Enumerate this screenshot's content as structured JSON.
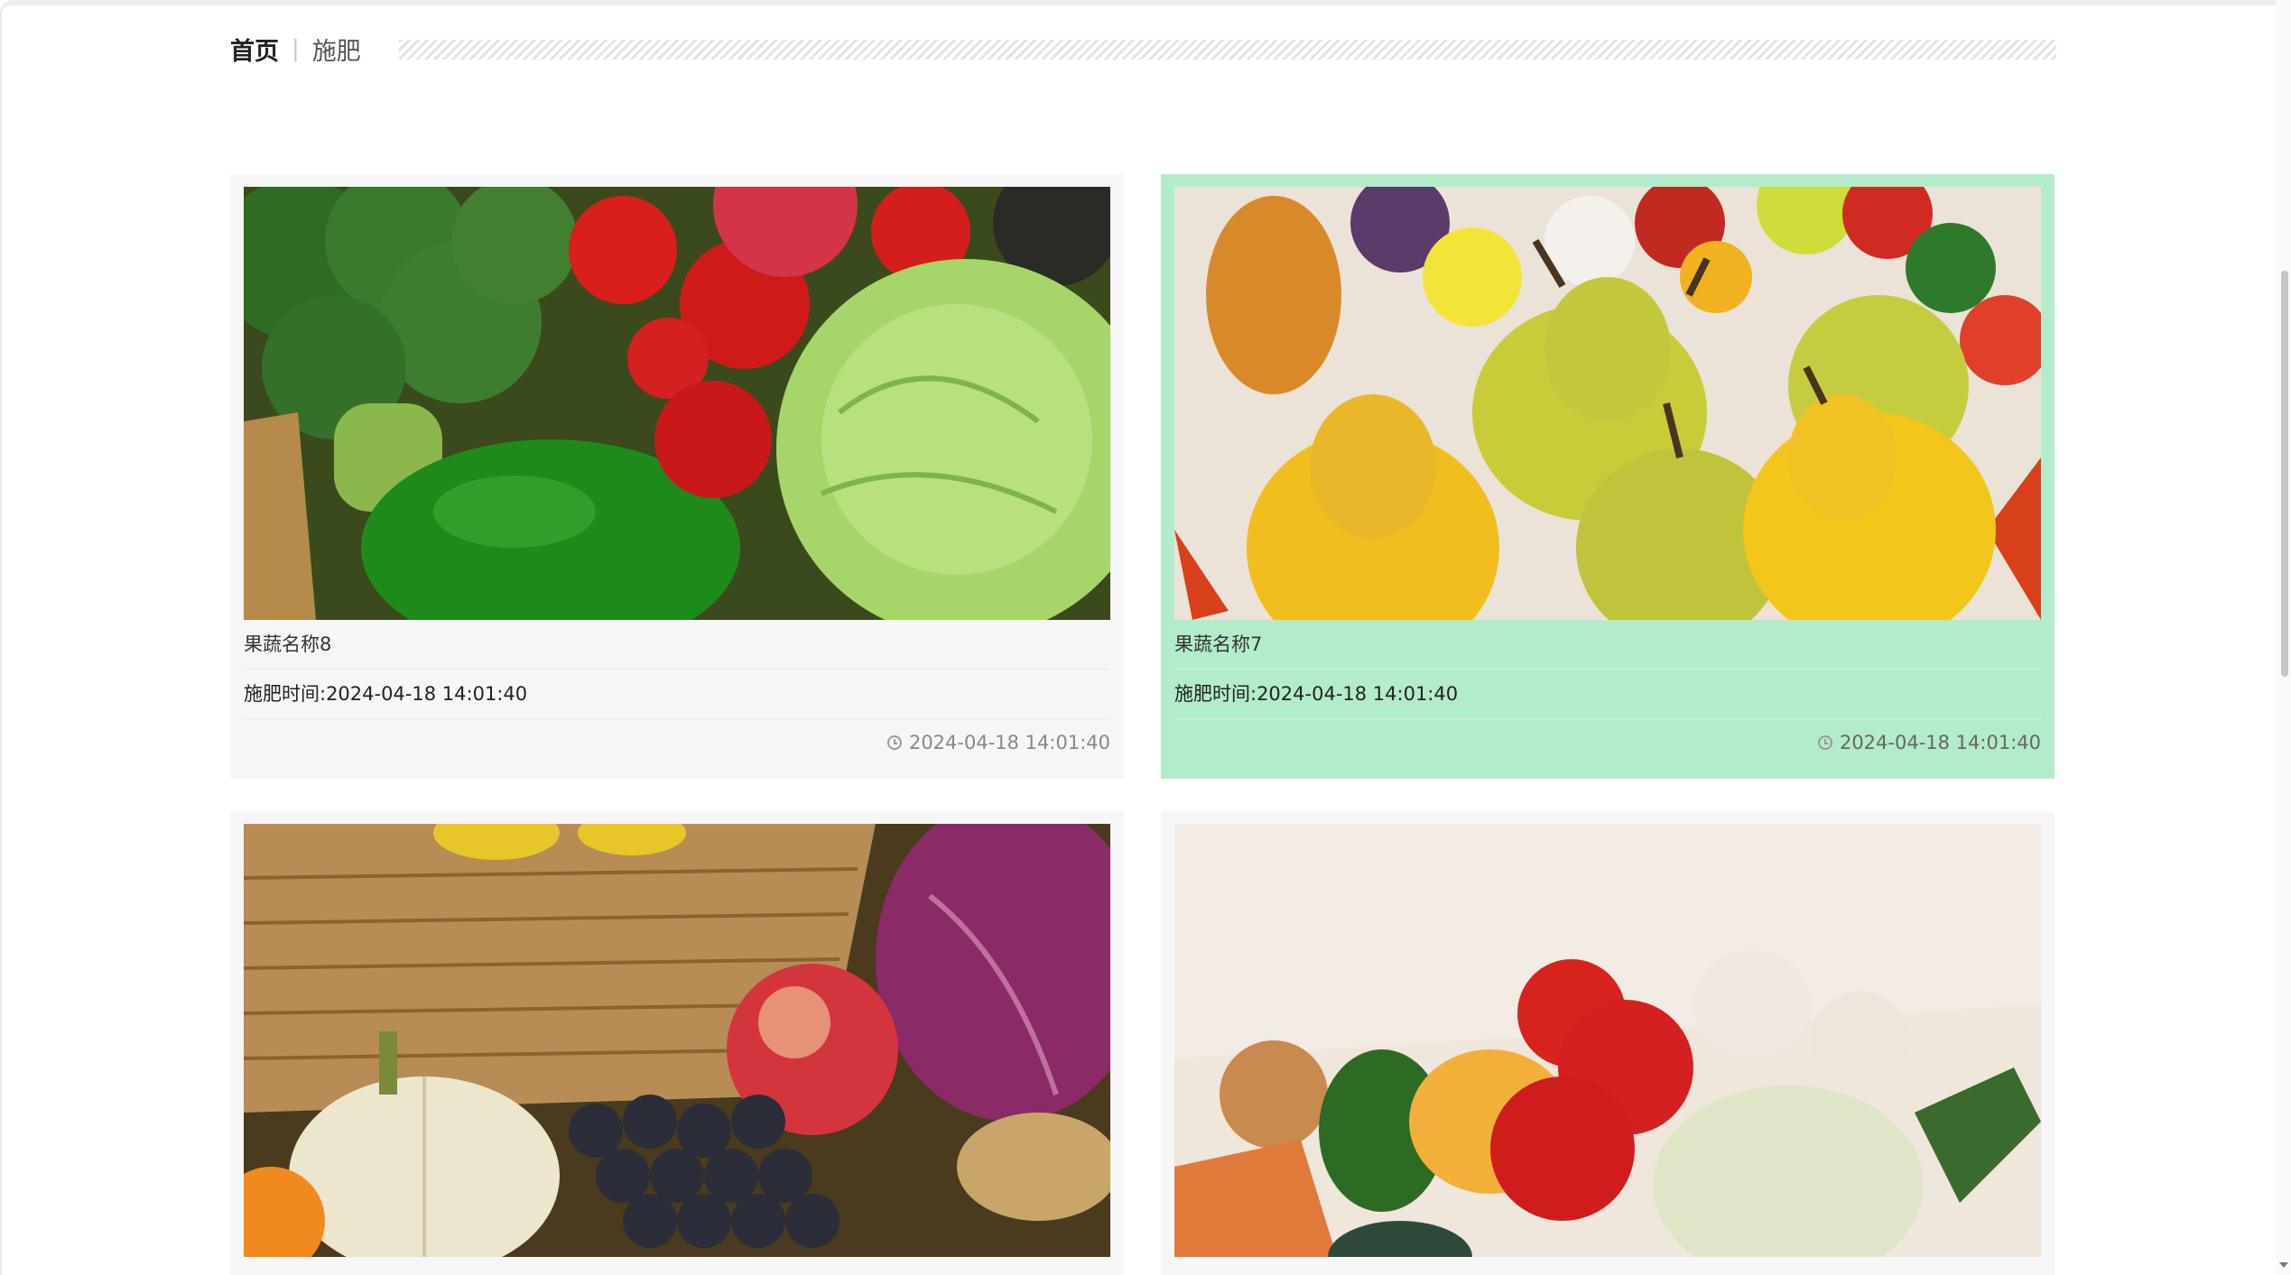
{
  "breadcrumb": {
    "home": "首页",
    "separator": "|",
    "current": "施肥"
  },
  "cards": [
    {
      "name": "果蔬名称8",
      "fertilize_time": "施肥时间:2024-04-18 14:01:40",
      "timestamp": "2024-04-18 14:01:40",
      "image": "vegetables-broccoli-tomato-cabbage",
      "active": false
    },
    {
      "name": "果蔬名称7",
      "fertilize_time": "施肥时间:2024-04-18 14:01:40",
      "timestamp": "2024-04-18 14:01:40",
      "image": "pears-and-fruits",
      "active": true
    },
    {
      "name": "",
      "fertilize_time": "",
      "timestamp": "",
      "image": "basket-grapes-pumpkin-cabbage",
      "active": false
    },
    {
      "name": "",
      "fertilize_time": "",
      "timestamp": "",
      "image": "tomatoes-garlic-cucumber-cabbage",
      "active": false
    }
  ],
  "colors": {
    "active_card": "#b3ecca",
    "card_bg": "#f6f6f6"
  }
}
